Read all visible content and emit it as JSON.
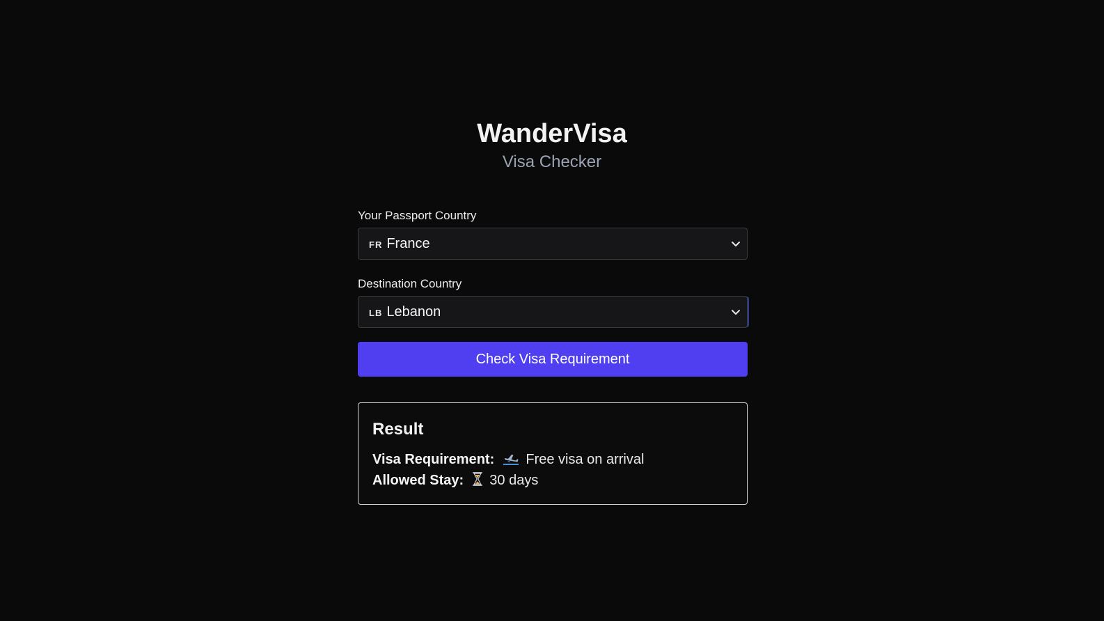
{
  "app": {
    "title": "WanderVisa",
    "subtitle": "Visa Checker"
  },
  "form": {
    "passport": {
      "label": "Your Passport Country",
      "flag_code": "FR",
      "selected": "France"
    },
    "destination": {
      "label": "Destination Country",
      "flag_code": "LB",
      "selected": "Lebanon"
    },
    "submit_label": "Check Visa Requirement"
  },
  "result": {
    "heading": "Result",
    "requirement_key": "Visa Requirement:",
    "requirement_icon": "airplane-arrival-icon",
    "requirement_value": "Free visa on arrival",
    "stay_key": "Allowed Stay:",
    "stay_icon": "hourglass-icon",
    "stay_value": "30 days"
  },
  "colors": {
    "background": "#0a0a0b",
    "accent": "#4f3ff0",
    "subtitle": "#9aa3b2"
  }
}
